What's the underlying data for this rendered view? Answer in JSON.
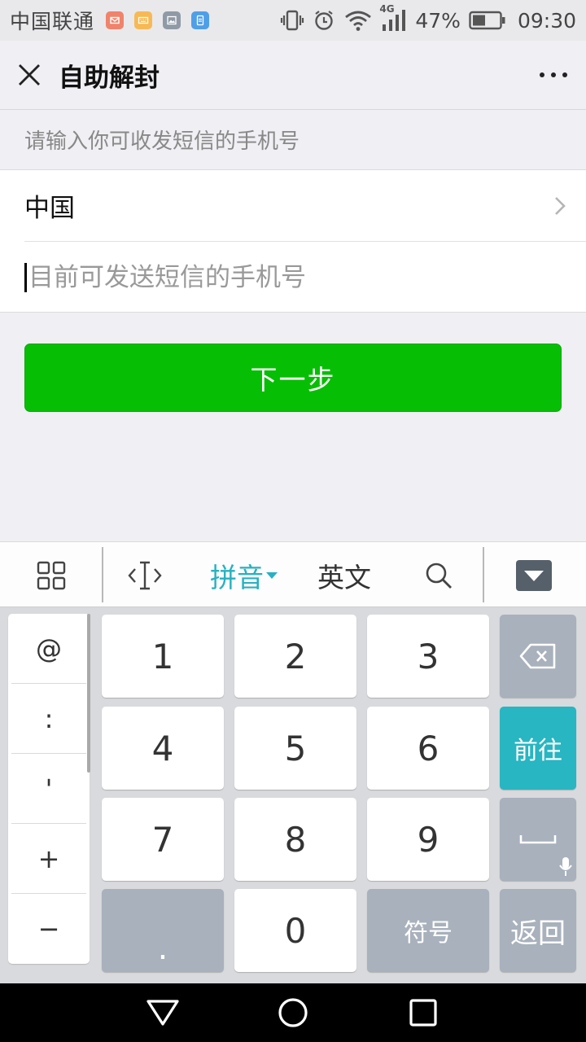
{
  "status_bar": {
    "carrier": "中国联通",
    "network": "4G",
    "battery_percent": "47%",
    "time": "09:30",
    "notification_icons": [
      "mail-icon",
      "keyboard-icon",
      "image-icon",
      "sim-icon"
    ],
    "notification_colors": [
      "#f0836b",
      "#f7b955",
      "#8f9aa6",
      "#4f9fe8"
    ]
  },
  "nav": {
    "title": "自助解封"
  },
  "form": {
    "hint": "请输入你可收发短信的手机号",
    "country": "中国",
    "phone_value": "",
    "phone_placeholder": "目前可发送短信的手机号"
  },
  "next_button": {
    "label": "下一步",
    "color": "#06bf04"
  },
  "ime_toolbar": {
    "pinyin": "拼音",
    "english": "英文",
    "accent_color": "#27b1c0"
  },
  "keyboard": {
    "symbols": [
      "@",
      ":",
      "'",
      "+",
      "−"
    ],
    "digits": [
      "1",
      "2",
      "3",
      "4",
      "5",
      "6",
      "7",
      "8",
      "9",
      "0"
    ],
    "dot": ".",
    "go": "前往",
    "symbols_key": "符号",
    "back": "返回",
    "go_color": "#27b6c2"
  }
}
